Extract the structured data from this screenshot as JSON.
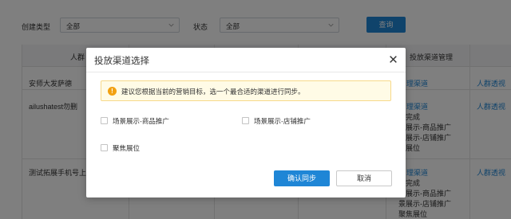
{
  "filters": {
    "create_type_label": "创建类型",
    "create_type_value": "全部",
    "status_label": "状态",
    "status_value": "全部",
    "query_button": "查询"
  },
  "table": {
    "headers": [
      "人群",
      "投放渠道管理"
    ],
    "rows": [
      {
        "name": "安师大发萨德",
        "channel_link": "理渠道",
        "action": "人群透视",
        "channel_lines": []
      },
      {
        "name": "ailushatest勿删",
        "channel_link": "理渠道",
        "action": "人群透视",
        "channel_lines": [
          "步完成",
          "景展示-商品推广",
          "景展示-店铺推广",
          "焦展位"
        ]
      },
      {
        "name": "测试拓展手机号上传",
        "channel_link": "理渠道",
        "action": "人群透视",
        "channel_lines": [
          "步完成",
          "景展示-商品推广",
          "景展示-店铺推广",
          "聚焦展位"
        ]
      }
    ]
  },
  "modal": {
    "title": "投放渠道选择",
    "notice": "建议您根据当前的营销目标，选一个最合适的渠道进行同步。",
    "options": [
      {
        "label": "场景展示-商品推广",
        "checked": false
      },
      {
        "label": "场景展示-店铺推广",
        "checked": false
      },
      {
        "label": "聚焦展位",
        "checked": false
      }
    ],
    "confirm_button": "确认同步",
    "cancel_button": "取消"
  },
  "colors": {
    "primary": "#1f86d6",
    "warning_bg": "#fffbe6",
    "warning_icon": "#f2a111"
  }
}
